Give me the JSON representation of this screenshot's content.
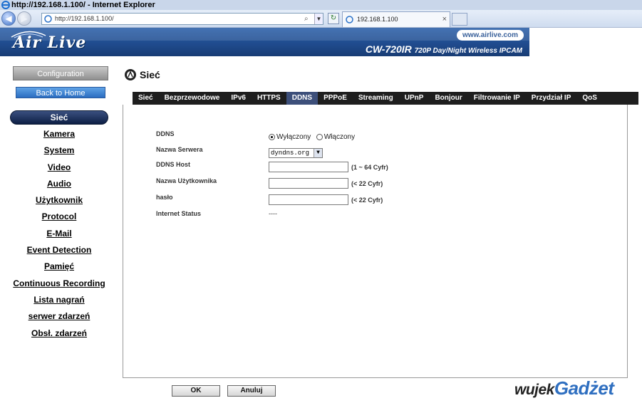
{
  "browser": {
    "window_title": "http://192.168.1.100/ - Internet Explorer",
    "address": "http://192.168.1.100/",
    "tab_title": "192.168.1.100"
  },
  "banner": {
    "brand": "Air Live",
    "site": "www.airlive.com",
    "model": "CW-720IR",
    "model_desc": "720P Day/Night Wireless IPCAM"
  },
  "sidebar": {
    "config_label": "Configuration",
    "home_label": "Back to Home",
    "active": "Sieć",
    "items": [
      "Kamera",
      "System",
      "Video",
      "Audio",
      "Użytkownik",
      "Protocol",
      "E-Mail",
      "Event Detection",
      "Pamięć",
      "Continuous Recording",
      "Lista nagrań",
      "serwer zdarzeń",
      "Obsł. zdarzeń"
    ]
  },
  "page": {
    "title": "Sieć"
  },
  "tabs": [
    "Sieć",
    "Bezprzewodowe",
    "IPv6",
    "HTTPS",
    "DDNS",
    "PPPoE",
    "Streaming",
    "UPnP",
    "Bonjour",
    "Filtrowanie IP",
    "Przydział IP",
    "QoS"
  ],
  "form": {
    "ddns_label": "DDNS",
    "off_label": "Wyłączony",
    "on_label": "Włączony",
    "server_label": "Nazwa Serwera",
    "server_value": "dyndns.org",
    "host_label": "DDNS Host",
    "host_hint": "(1 ~ 64 Cyfr)",
    "user_label": "Nazwa Użytkownika",
    "user_hint": "(< 22 Cyfr)",
    "pass_label": "hasło",
    "pass_hint": "(< 22 Cyfr)",
    "status_label": "Internet Status",
    "status_value": "----"
  },
  "buttons": {
    "ok": "OK",
    "cancel": "Anuluj"
  },
  "watermark": {
    "part1": "wujek",
    "part2": "Gadżet"
  }
}
